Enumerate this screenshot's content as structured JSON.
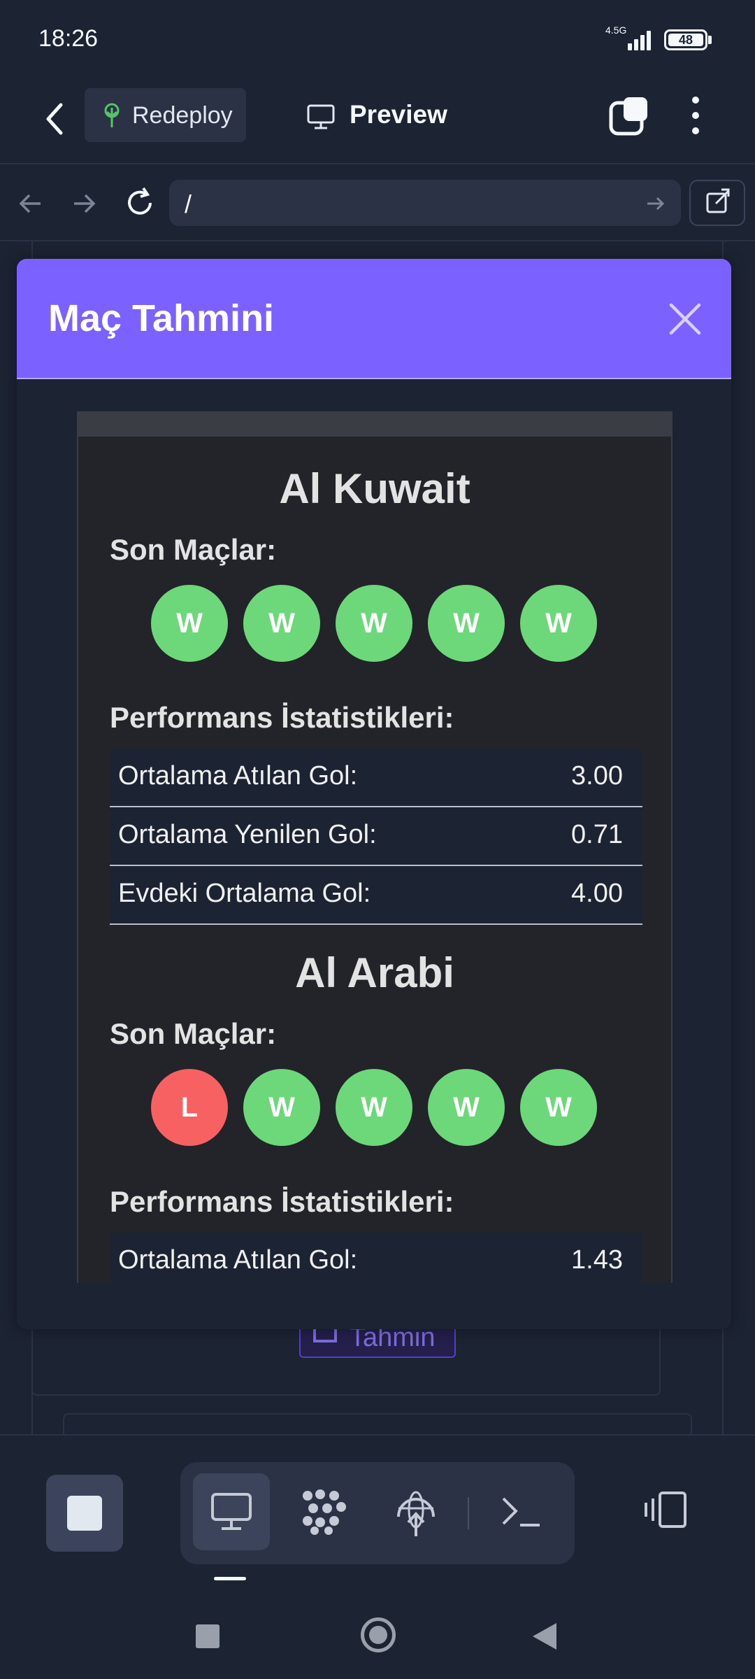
{
  "status_bar": {
    "time": "18:26",
    "network": "4.5G",
    "battery": "48"
  },
  "app_bar": {
    "redeploy_label": "Redeploy",
    "preview_label": "Preview",
    "icons": [
      "back-arrow-icon",
      "redeploy-tree-icon",
      "monitor-icon",
      "tabs-icon",
      "more-vertical-icon"
    ]
  },
  "url_bar": {
    "url": "/",
    "icons": [
      "nav-back-icon",
      "nav-forward-icon",
      "reload-icon",
      "go-arrow-icon",
      "external-link-icon"
    ]
  },
  "background": {
    "tahmin_label": "Tahmin"
  },
  "modal": {
    "title": "Maç Tahmini",
    "accent": "#7b61ff",
    "teams": [
      {
        "name": "Al Kuwait",
        "recent_label": "Son Maçlar:",
        "recent": [
          "W",
          "W",
          "W",
          "W",
          "W"
        ],
        "stats_label": "Performans İstatistikleri:",
        "stats": [
          {
            "label": "Ortalama Atılan Gol:",
            "value": "3.00"
          },
          {
            "label": "Ortalama Yenilen Gol:",
            "value": "0.71"
          },
          {
            "label": "Evdeki Ortalama Gol:",
            "value": "4.00"
          }
        ]
      },
      {
        "name": "Al Arabi",
        "recent_label": "Son Maçlar:",
        "recent": [
          "L",
          "W",
          "W",
          "W",
          "W"
        ],
        "stats_label": "Performans İstatistikleri:",
        "stats": [
          {
            "label": "Ortalama Atılan Gol:",
            "value": "1.43"
          }
        ]
      }
    ],
    "colors": {
      "win": "#6dd87a",
      "loss": "#f76161"
    }
  },
  "bottom_bar": {
    "tools": [
      "stop-icon",
      "monitor-icon",
      "dots-grid-icon",
      "globe-upload-icon",
      "terminal-icon",
      "split-view-icon"
    ]
  }
}
